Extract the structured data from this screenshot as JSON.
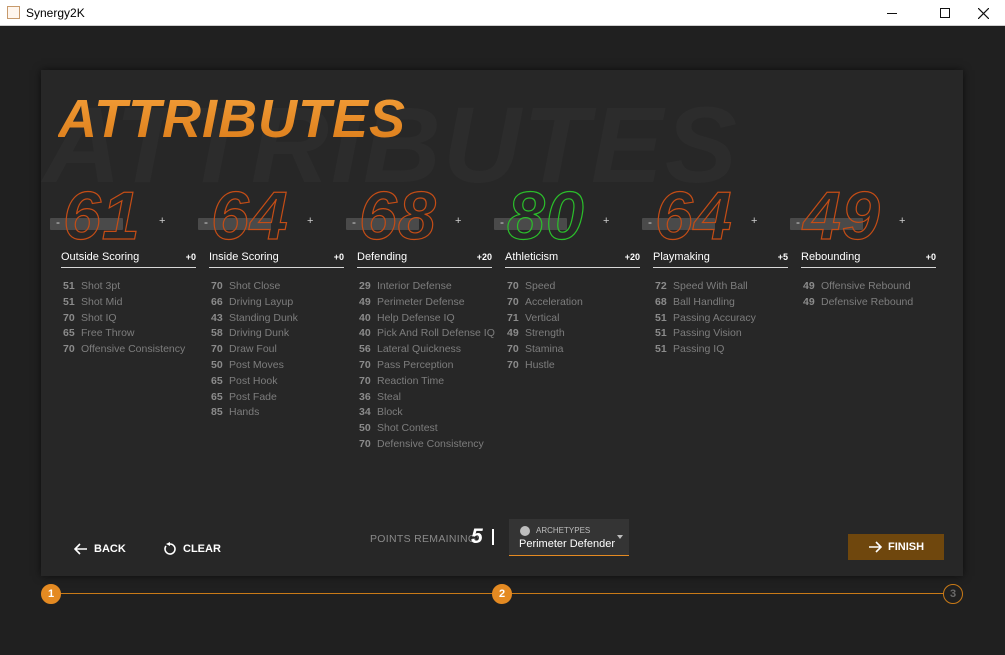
{
  "window": {
    "title": "Synergy2K"
  },
  "page": {
    "title": "ATTRIBUTES",
    "bg_title": "ATTRIBUTES"
  },
  "categories": [
    {
      "name": "Outside Scoring",
      "score": "61",
      "bonus": "+0",
      "color": "#c44d16",
      "attributes": [
        {
          "value": "51",
          "name": "Shot 3pt"
        },
        {
          "value": "51",
          "name": "Shot Mid"
        },
        {
          "value": "70",
          "name": "Shot IQ"
        },
        {
          "value": "65",
          "name": "Free Throw"
        },
        {
          "value": "70",
          "name": "Offensive Consistency"
        }
      ]
    },
    {
      "name": "Inside Scoring",
      "score": "64",
      "bonus": "+0",
      "color": "#c44d16",
      "attributes": [
        {
          "value": "70",
          "name": "Shot Close"
        },
        {
          "value": "66",
          "name": "Driving Layup"
        },
        {
          "value": "43",
          "name": "Standing Dunk"
        },
        {
          "value": "58",
          "name": "Driving Dunk"
        },
        {
          "value": "70",
          "name": "Draw Foul"
        },
        {
          "value": "50",
          "name": "Post Moves"
        },
        {
          "value": "65",
          "name": "Post Hook"
        },
        {
          "value": "65",
          "name": "Post Fade"
        },
        {
          "value": "85",
          "name": "Hands"
        }
      ]
    },
    {
      "name": "Defending",
      "score": "68",
      "bonus": "+20",
      "color": "#c44d16",
      "attributes": [
        {
          "value": "29",
          "name": "Interior Defense"
        },
        {
          "value": "49",
          "name": "Perimeter Defense"
        },
        {
          "value": "40",
          "name": "Help Defense IQ"
        },
        {
          "value": "40",
          "name": "Pick And Roll Defense IQ"
        },
        {
          "value": "56",
          "name": "Lateral Quickness"
        },
        {
          "value": "70",
          "name": "Pass Perception"
        },
        {
          "value": "70",
          "name": "Reaction Time"
        },
        {
          "value": "36",
          "name": "Steal"
        },
        {
          "value": "34",
          "name": "Block"
        },
        {
          "value": "50",
          "name": "Shot Contest"
        },
        {
          "value": "70",
          "name": "Defensive Consistency"
        }
      ]
    },
    {
      "name": "Athleticism",
      "score": "80",
      "bonus": "+20",
      "color": "#2bbf2b",
      "attributes": [
        {
          "value": "70",
          "name": "Speed"
        },
        {
          "value": "70",
          "name": "Acceleration"
        },
        {
          "value": "71",
          "name": "Vertical"
        },
        {
          "value": "49",
          "name": "Strength"
        },
        {
          "value": "70",
          "name": "Stamina"
        },
        {
          "value": "70",
          "name": "Hustle"
        }
      ]
    },
    {
      "name": "Playmaking",
      "score": "64",
      "bonus": "+5",
      "color": "#c44d16",
      "attributes": [
        {
          "value": "72",
          "name": "Speed With Ball"
        },
        {
          "value": "68",
          "name": "Ball Handling"
        },
        {
          "value": "51",
          "name": "Passing Accuracy"
        },
        {
          "value": "51",
          "name": "Passing Vision"
        },
        {
          "value": "51",
          "name": "Passing IQ"
        }
      ]
    },
    {
      "name": "Rebounding",
      "score": "49",
      "bonus": "+0",
      "color": "#c44d16",
      "attributes": [
        {
          "value": "49",
          "name": "Offensive Rebound"
        },
        {
          "value": "49",
          "name": "Defensive Rebound"
        }
      ]
    }
  ],
  "controls": {
    "minus": "-",
    "plus": "+",
    "back": "BACK",
    "clear": "CLEAR",
    "points_label": "POINTS REMAINING:",
    "points_value": "5",
    "archetype_label": "ARCHETYPES",
    "archetype_value": "Perimeter Defender",
    "finish": "FINISH"
  },
  "steps": [
    "1",
    "2",
    "3"
  ],
  "colors": {
    "accent": "#e48a22",
    "finish_bg": "#6f470d",
    "green": "#2bbf2b",
    "score_outline": "#c44d16"
  }
}
